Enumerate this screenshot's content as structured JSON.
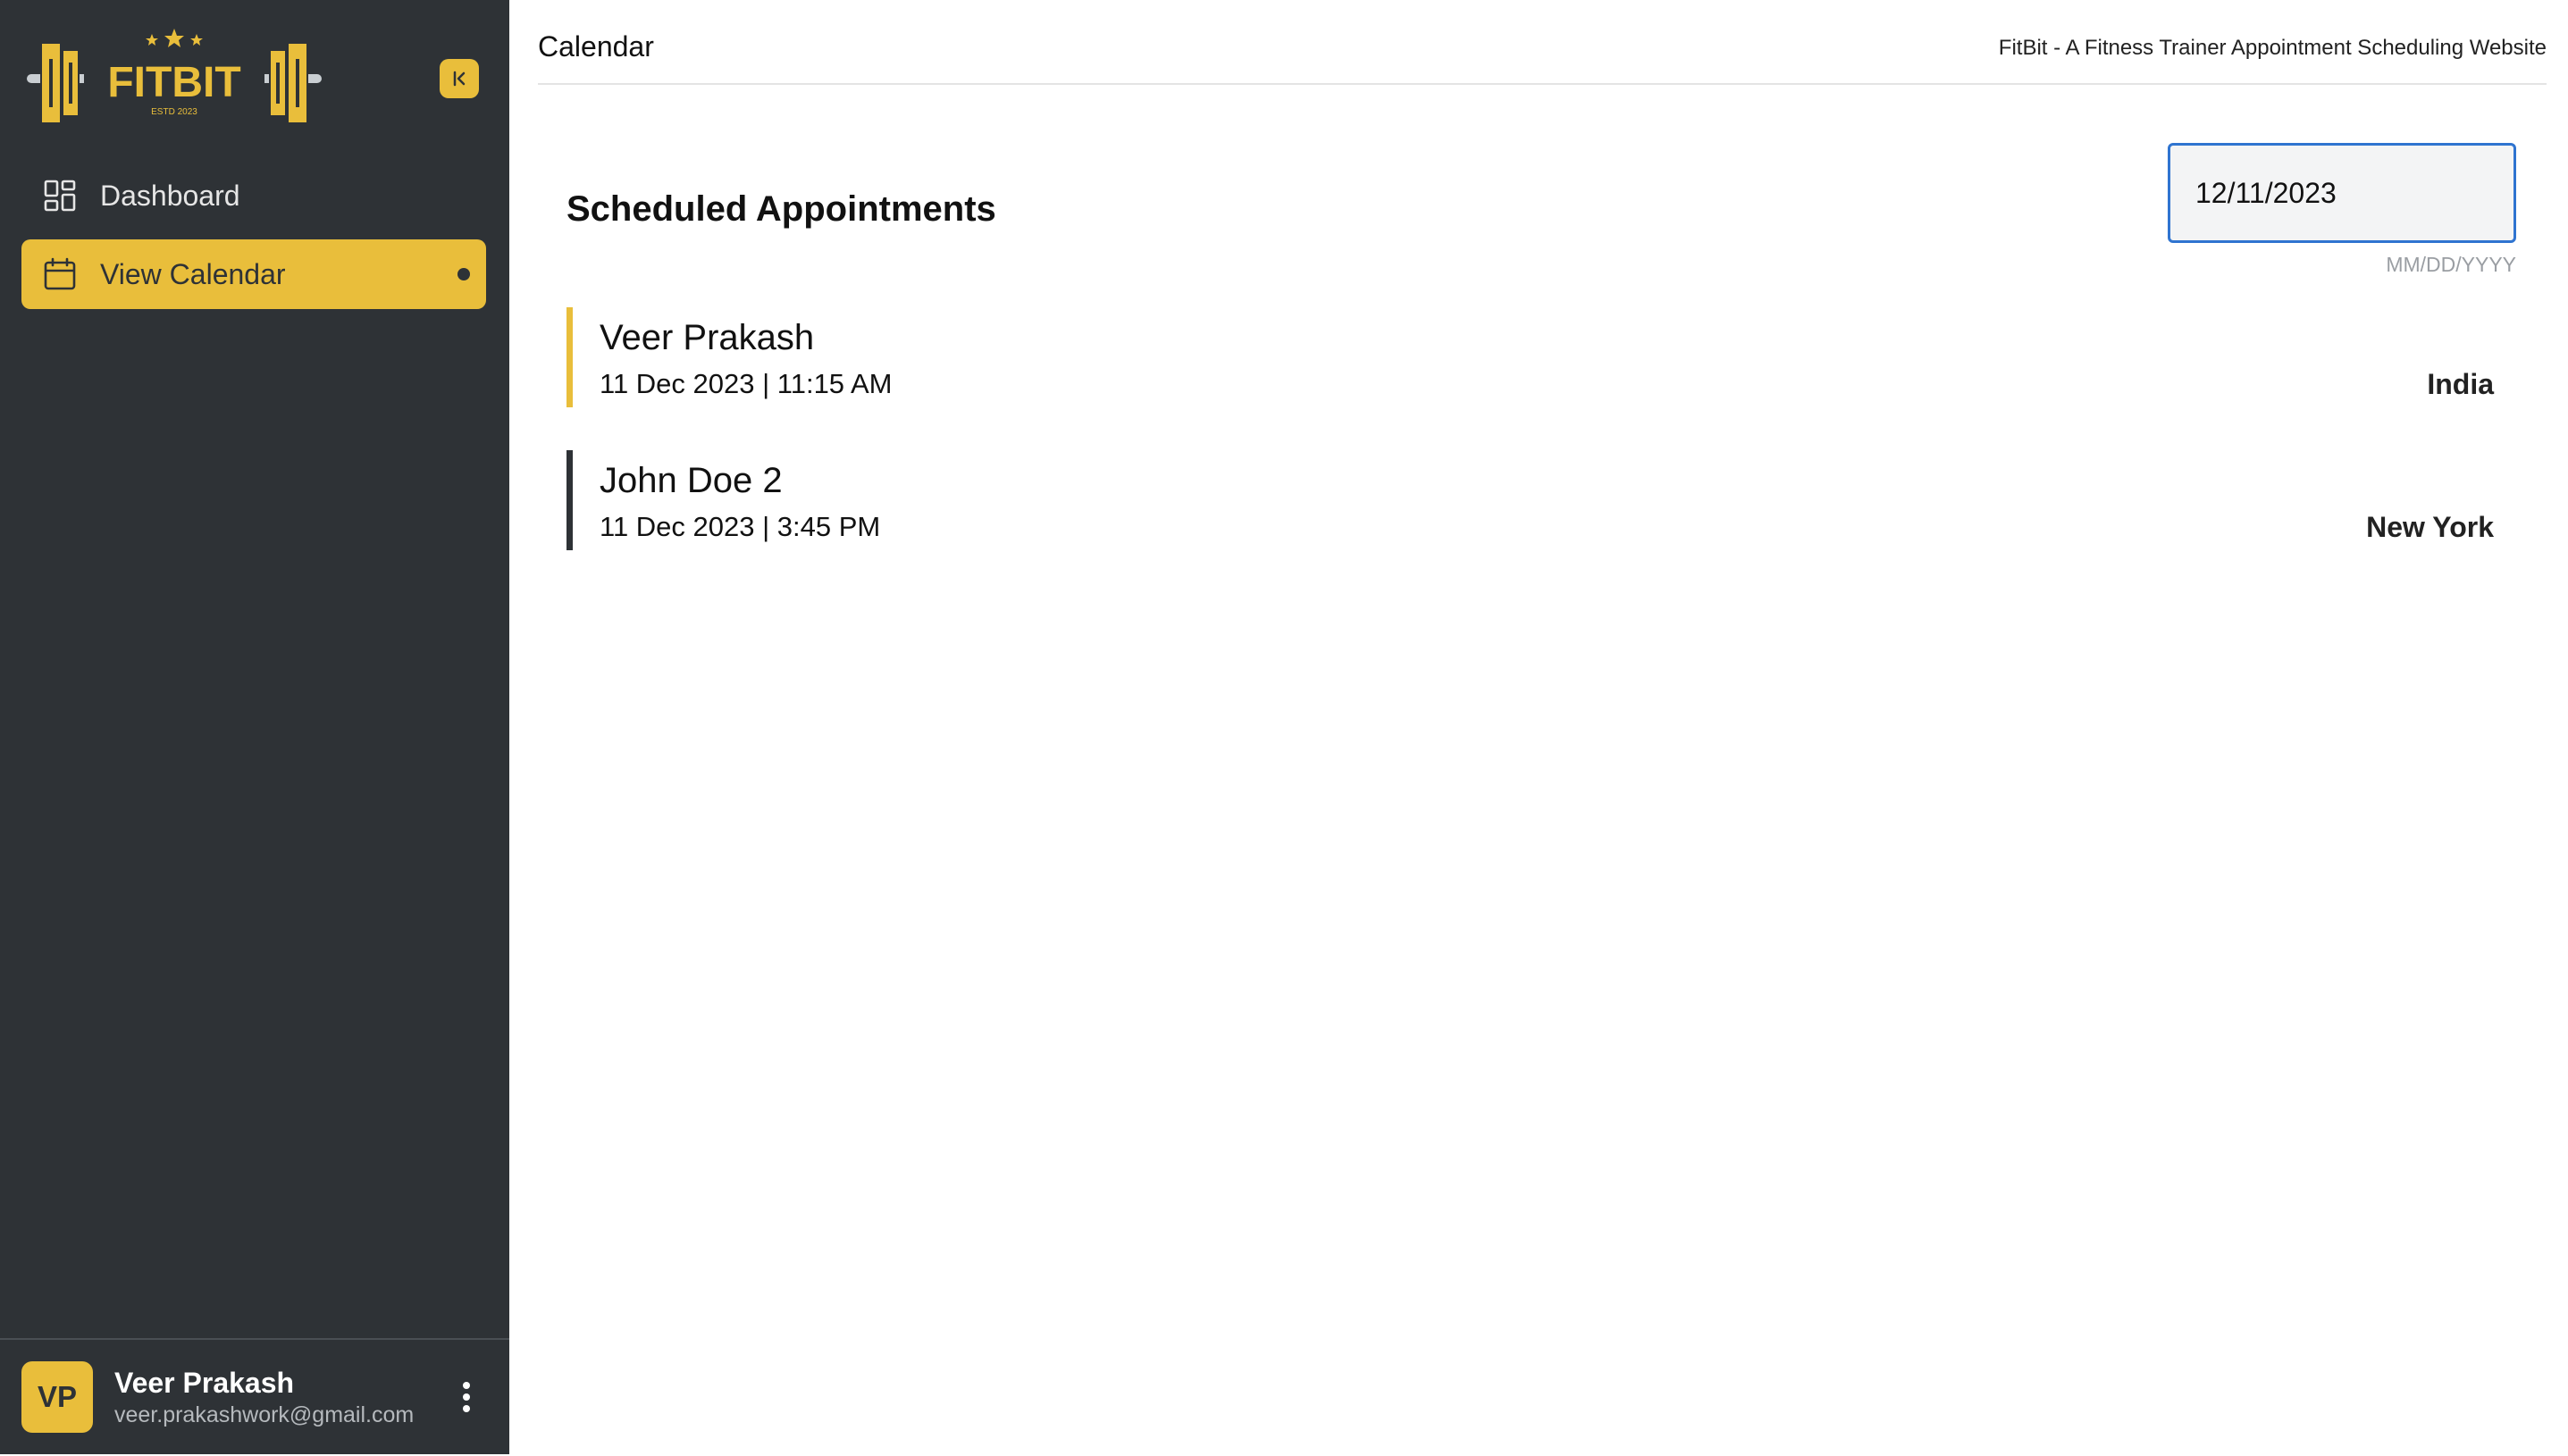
{
  "sidebar": {
    "logo": {
      "text": "FITBIT",
      "tagline": "ESTD 2023",
      "colors": {
        "primary": "#e9be3b",
        "secondary": "#c9ced2"
      }
    },
    "collapse_icon": "collapse-left-icon",
    "nav": [
      {
        "label": "Dashboard",
        "icon": "dashboard-grid-icon",
        "active": false
      },
      {
        "label": "View Calendar",
        "icon": "calendar-icon",
        "active": true
      }
    ],
    "user": {
      "initials": "VP",
      "name": "Veer Prakash",
      "email": "veer.prakashwork@gmail.com"
    }
  },
  "header": {
    "title": "Calendar",
    "site_title": "FitBit - A Fitness Trainer Appointment Scheduling Website"
  },
  "main": {
    "section_title": "Scheduled Appointments",
    "date_input": {
      "value": "12/11/2023",
      "hint": "MM/DD/YYYY"
    },
    "appointments": [
      {
        "name": "Veer Prakash",
        "datetime": "11 Dec 2023 | 11:15 AM",
        "location": "India",
        "accent": "#e9be3b"
      },
      {
        "name": "John Doe 2",
        "datetime": "11 Dec 2023 | 3:45 PM",
        "location": "New York",
        "accent": "#2e3236"
      }
    ]
  },
  "colors": {
    "sidebar_bg": "#2e3236",
    "accent": "#e9be3b",
    "focus_border": "#2f74d0"
  }
}
